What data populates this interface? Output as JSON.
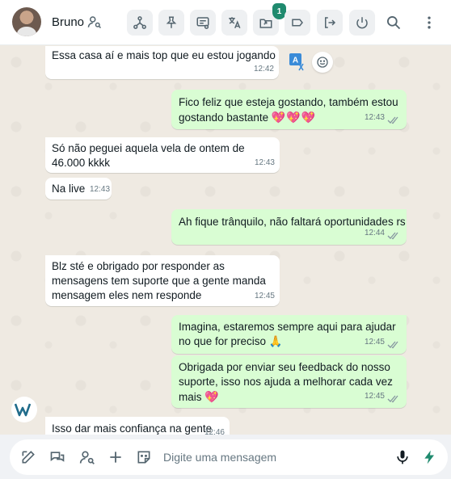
{
  "header": {
    "contact_name": "Bruno",
    "badge_count": "1",
    "buttons": [
      "share-network-icon",
      "pin-icon",
      "message-settings-icon",
      "translate-icon",
      "export-icon",
      "label-icon",
      "exit-icon",
      "power-icon"
    ]
  },
  "messages": [
    {
      "dir": "in",
      "text": "Essa casa aí e mais top que eu estou jogando",
      "time": "12:42"
    },
    {
      "dir": "out",
      "text": "Fico feliz que esteja gostando, também estou gostando bastante",
      "emoji": "💖💖💖",
      "time": "12:43"
    },
    {
      "dir": "in",
      "text": "Só não peguei aquela vela de ontem de 46.000 kkkk",
      "time": "12:43"
    },
    {
      "dir": "in",
      "text": "Na live",
      "time": "12:43"
    },
    {
      "dir": "out",
      "text": "Ah fique trânquilo, não faltará oportunidades rs",
      "time": "12:44"
    },
    {
      "dir": "in",
      "text": "Blz sté e obrigado por responder as mensagens tem suporte que a gente manda mensagem eles nem responde",
      "time": "12:45"
    },
    {
      "dir": "out",
      "text": "Imagina, estaremos sempre aqui para ajudar no que for preciso",
      "emoji": "🙏",
      "time": "12:45"
    },
    {
      "dir": "out",
      "text": "Obrigada por enviar seu feedback do nosso suporte, isso nos ajuda a melhorar cada vez mais",
      "emoji": "💖",
      "time": "12:45"
    },
    {
      "dir": "in",
      "text": "Isso dar mais confiança na gente",
      "time": "12:46"
    }
  ],
  "composer": {
    "placeholder": "Digite uma mensagem"
  },
  "colors": {
    "incoming": "#ffffff",
    "outgoing": "#d9fdd3",
    "accent": "#1f8a6e",
    "background": "#efeae2"
  }
}
